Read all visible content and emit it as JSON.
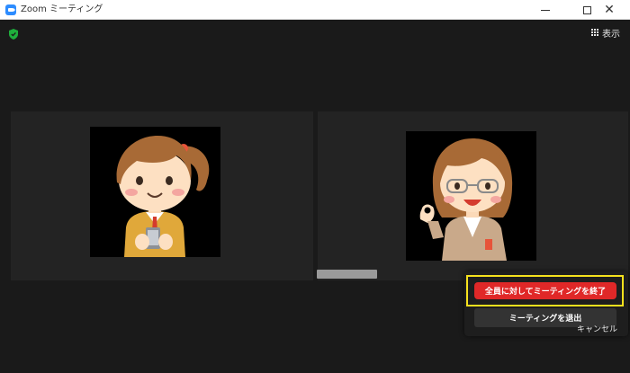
{
  "window": {
    "title": "Zoom ミーティング",
    "close_glyph": "✕"
  },
  "toolbar": {
    "view_label": "表示"
  },
  "icons": {
    "app": "zoom-camera-icon",
    "security": "shield-check-icon",
    "view": "grid-icon"
  },
  "colors": {
    "accent_blue": "#2d8cff",
    "end_button": "#e02828",
    "highlight_box": "#f5e11d",
    "shield_green": "#1fae3c"
  },
  "participants": [
    {
      "kind": "female-with-ponytail-holding-phone"
    },
    {
      "kind": "female-with-glasses-ok-gesture"
    }
  ],
  "end_popup": {
    "end_for_all_label": "全員に対してミーティングを終了",
    "leave_label": "ミーティングを退出",
    "cancel_label": "キャンセル"
  }
}
